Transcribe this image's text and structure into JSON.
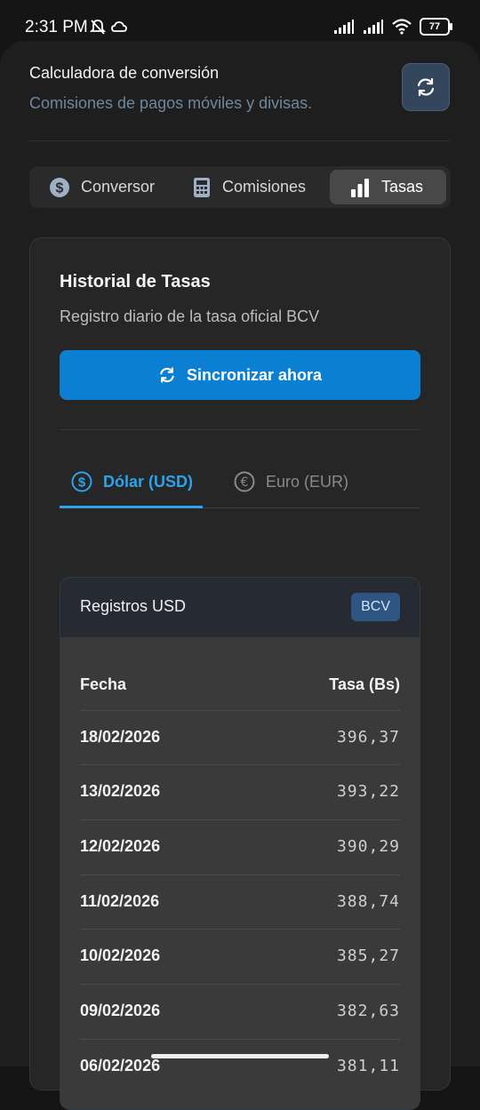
{
  "status_bar": {
    "time": "2:31 PM",
    "battery": "77"
  },
  "header": {
    "title": "Calculadora de conversión",
    "subtitle": "Comisiones de pagos móviles y divisas.",
    "refresh_icon": "refresh-icon"
  },
  "tabs": [
    {
      "label": "Conversor",
      "icon": "dollar-circle-icon"
    },
    {
      "label": "Comisiones",
      "icon": "calculator-icon"
    },
    {
      "label": "Tasas",
      "icon": "bar-chart-icon",
      "active": true
    }
  ],
  "card": {
    "title": "Historial de Tasas",
    "subtitle": "Registro diario de la tasa oficial BCV",
    "sync_label": "Sincronizar ahora"
  },
  "currency_tabs": [
    {
      "label": "Dólar (USD)",
      "icon": "dollar-circle-icon",
      "active": true
    },
    {
      "label": "Euro (EUR)",
      "icon": "euro-circle-icon"
    }
  ],
  "table": {
    "title": "Registros USD",
    "badge": "BCV",
    "columns": [
      "Fecha",
      "Tasa (Bs)"
    ],
    "rows": [
      {
        "date": "18/02/2026",
        "rate": "396,37"
      },
      {
        "date": "13/02/2026",
        "rate": "393,22"
      },
      {
        "date": "12/02/2026",
        "rate": "390,29"
      },
      {
        "date": "11/02/2026",
        "rate": "388,74"
      },
      {
        "date": "10/02/2026",
        "rate": "385,27"
      },
      {
        "date": "09/02/2026",
        "rate": "382,63"
      },
      {
        "date": "06/02/2026",
        "rate": "381,11"
      }
    ]
  },
  "colors": {
    "accent": "#0b7fd1",
    "active_tab_text": "#2aa4ea",
    "badge_bg": "#2f5683"
  }
}
